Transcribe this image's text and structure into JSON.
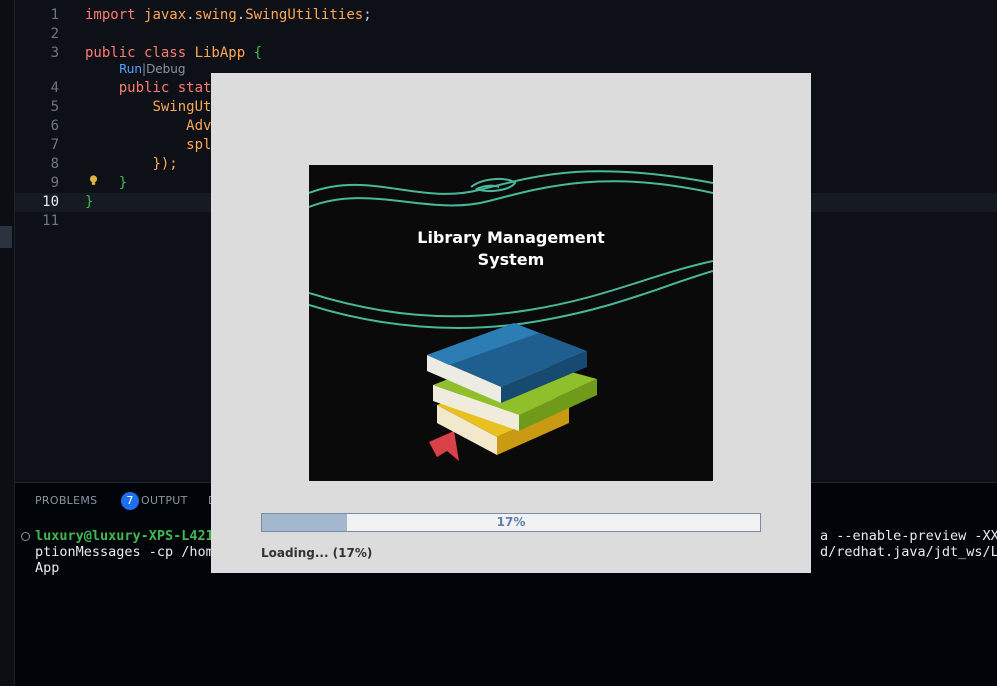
{
  "editor": {
    "lines": [
      {
        "num": "1",
        "parts": [
          [
            "kw",
            "import "
          ],
          [
            "ty",
            "javax"
          ],
          [
            "pl",
            "."
          ],
          [
            "ty",
            "swing"
          ],
          [
            "pl",
            "."
          ],
          [
            "ty",
            "SwingUtilities"
          ],
          [
            "pl",
            ";"
          ]
        ]
      },
      {
        "num": "2",
        "parts": []
      },
      {
        "num": "3",
        "parts": [
          [
            "kw",
            "public class "
          ],
          [
            "id",
            "LibApp "
          ],
          [
            "br",
            "{"
          ]
        ]
      },
      {
        "num": "4",
        "parts": [
          [
            "pl",
            "    "
          ],
          [
            "kw",
            "public stat"
          ]
        ]
      },
      {
        "num": "5",
        "parts": [
          [
            "pl",
            "        "
          ],
          [
            "ty",
            "SwingUt"
          ]
        ]
      },
      {
        "num": "6",
        "parts": [
          [
            "pl",
            "            "
          ],
          [
            "ty",
            "Adv"
          ]
        ]
      },
      {
        "num": "7",
        "parts": [
          [
            "pl",
            "            "
          ],
          [
            "ty",
            "spl"
          ]
        ]
      },
      {
        "num": "8",
        "parts": [
          [
            "pl",
            "        "
          ],
          [
            "ty",
            "});"
          ]
        ]
      },
      {
        "num": "9",
        "parts": [
          [
            "pl",
            "    "
          ],
          [
            "br",
            "}"
          ]
        ]
      },
      {
        "num": "10",
        "parts": [
          [
            "br",
            "}"
          ]
        ]
      },
      {
        "num": "11",
        "parts": []
      }
    ],
    "current_line": "10",
    "codelens": {
      "run": "Run",
      "sep": "|",
      "debug": "Debug"
    }
  },
  "panel": {
    "tabs": {
      "problems": "PROBLEMS",
      "problems_count": "7",
      "output": "OUTPUT",
      "debug": "D"
    },
    "terminal": {
      "prompt": "luxury@luxury-XPS-L421",
      "line1_right": "a --enable-preview -XX:+",
      "line2_left": "ptionMessages -cp /hom",
      "line2_right": "d/redhat.java/jdt_ws/Li",
      "line3": "App"
    }
  },
  "splash": {
    "title_line1": "Library Management",
    "title_line2": "System",
    "progress": {
      "percent": 17,
      "label": "17%"
    },
    "status": "Loading... (17%)",
    "colors": {
      "progress_fill": "#a3b8cf",
      "book_blue": "#1f5f8f",
      "book_green": "#8fbf2a",
      "book_yellow": "#e8c020",
      "bookmark": "#d9404a",
      "swirl": "#48b89a"
    }
  }
}
